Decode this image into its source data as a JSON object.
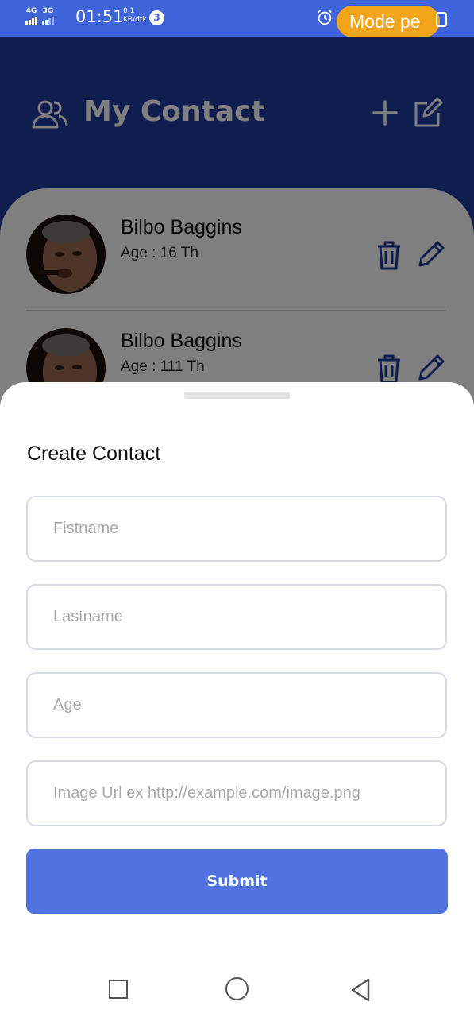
{
  "status_bar": {
    "net1": "4G",
    "net2": "3G",
    "time": "01:51",
    "speed_value": "0,1",
    "speed_unit": "KB/dtk",
    "notification_count": "3",
    "mode_label": "Mode pe"
  },
  "header": {
    "title": "My Contact",
    "icons": [
      "users-icon",
      "plus-icon",
      "edit-note-icon"
    ]
  },
  "contacts": [
    {
      "name": "Bilbo Baggins",
      "age": "Age : 16 Th"
    },
    {
      "name": "Bilbo Baggins",
      "age": "Age : 111 Th"
    }
  ],
  "form": {
    "title": "Create Contact",
    "firstname_placeholder": "Fistname",
    "lastname_placeholder": "Lastname",
    "age_placeholder": "Age",
    "image_placeholder": "Image Url ex http://example.com/image.png",
    "submit_label": "Submit"
  },
  "colors": {
    "status_bar": "#3f63d8",
    "header_bg": "#1e3a9e",
    "accent": "#5073df",
    "mode_pill": "#f2a51a"
  }
}
